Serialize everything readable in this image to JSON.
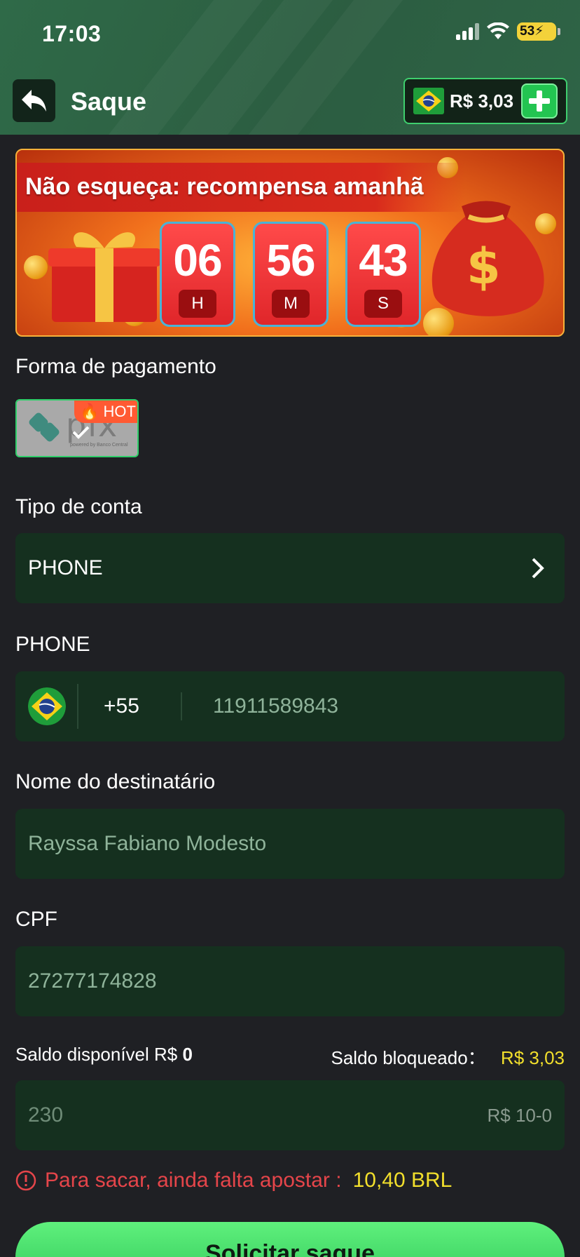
{
  "status_bar": {
    "time": "17:03",
    "battery": "53"
  },
  "header": {
    "title": "Saque",
    "balance": "R$ 3,03"
  },
  "banner": {
    "title": "Não esqueça: recompensa amanhã",
    "hours": "06",
    "hours_unit": "H",
    "minutes": "56",
    "minutes_unit": "M",
    "seconds": "43",
    "seconds_unit": "S"
  },
  "payment": {
    "label": "Forma de pagamento",
    "method_name": "pix",
    "method_sub": "powered by Banco Central",
    "badge": "HOT"
  },
  "account_type": {
    "label": "Tipo de conta",
    "value": "PHONE"
  },
  "phone": {
    "label": "PHONE",
    "country_code": "+55",
    "value": "11911589843"
  },
  "recipient": {
    "label": "Nome do destinatário",
    "value": "Rayssa Fabiano Modesto"
  },
  "cpf": {
    "label": "CPF",
    "value": "27277174828"
  },
  "balances": {
    "available_label": "Saldo disponível R$",
    "available_value": "0",
    "blocked_label": "Saldo bloqueado：",
    "blocked_value": "R$ 3,03"
  },
  "amount": {
    "placeholder": "230",
    "range": "R$ 10-0"
  },
  "warning": {
    "text": "Para sacar, ainda falta apostar :",
    "amount": "10,40 BRL"
  },
  "submit_label": "Solicitar saque",
  "colors": {
    "accent": "#2fc75a",
    "field_bg": "#15301f",
    "warning": "#e5454a",
    "highlight": "#f2df2c"
  }
}
